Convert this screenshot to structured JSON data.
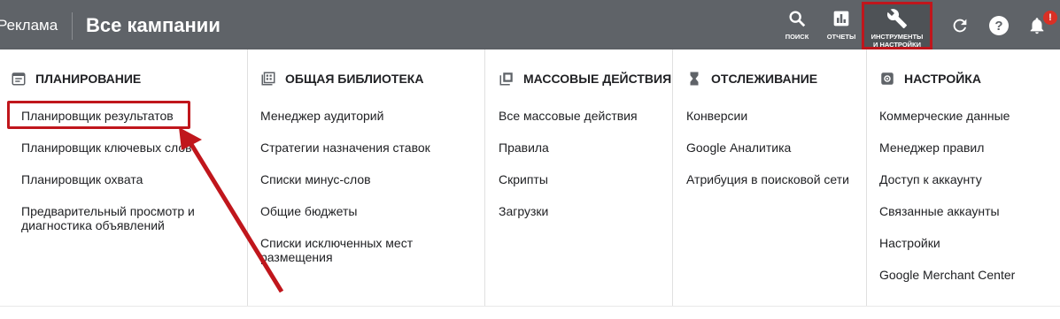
{
  "header": {
    "brand": "Реклама",
    "title": "Все кампании",
    "search_label": "ПОИСК",
    "reports_label": "ОТЧЕТЫ",
    "tools_label_line1": "ИНСТРУМЕНТЫ",
    "tools_label_line2": "И НАСТРОЙКИ",
    "notification_badge": "!"
  },
  "menu": {
    "planning": {
      "heading": "ПЛАНИРОВАНИЕ",
      "items": [
        "Планировщик результатов",
        "Планировщик ключевых слов",
        "Планировщик охвата",
        "Предварительный просмотр и",
        "диагностика объявлений"
      ]
    },
    "library": {
      "heading": "ОБЩАЯ БИБЛИОТЕКА",
      "items": [
        "Менеджер аудиторий",
        "Стратегии назначения ставок",
        "Списки минус-слов",
        "Общие бюджеты",
        "Списки исключенных мест",
        "размещения"
      ]
    },
    "bulk": {
      "heading": "МАССОВЫЕ ДЕЙСТВИЯ",
      "items": [
        "Все массовые действия",
        "Правила",
        "Скрипты",
        "Загрузки"
      ]
    },
    "tracking": {
      "heading": "ОТСЛЕЖИВАНИЕ",
      "items": [
        "Конверсии",
        "Google Аналитика",
        "Атрибуция в поисковой сети"
      ]
    },
    "setup": {
      "heading": "НАСТРОЙКА",
      "items": [
        "Коммерческие данные",
        "Менеджер правил",
        "Доступ к аккаунту",
        "Связанные аккаунты",
        "Настройки",
        "Google Merchant Center"
      ]
    }
  },
  "colors": {
    "topbar": "#5f6368",
    "annotation": "#c0161c"
  }
}
